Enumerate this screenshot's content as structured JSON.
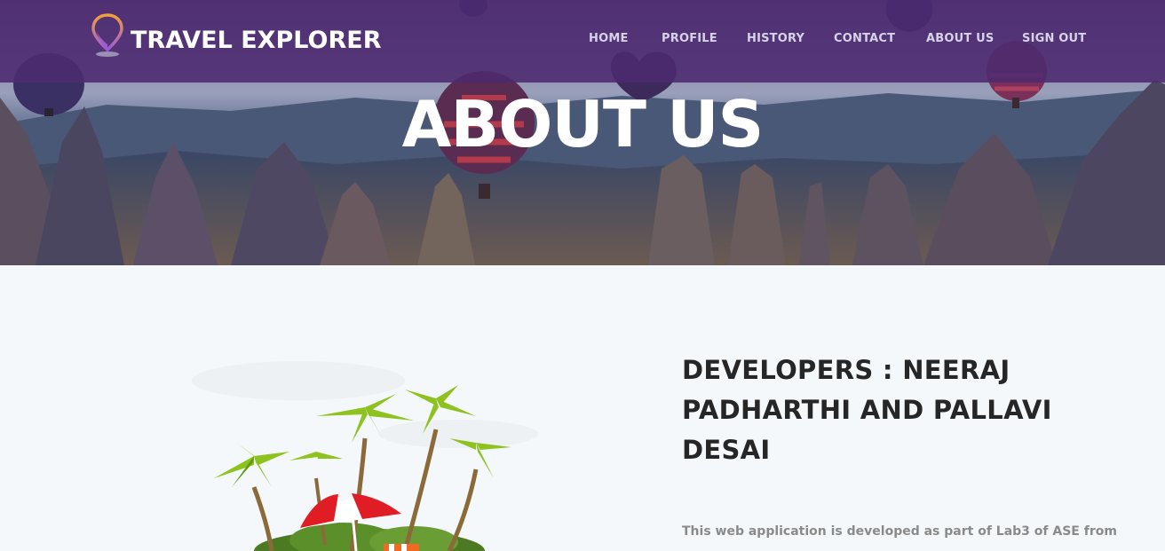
{
  "brand": {
    "name": "TRAVEL EXPLORER",
    "pin_color_top": "#f0a23a",
    "pin_color_bottom": "#9b5ad6"
  },
  "nav": {
    "items": [
      {
        "label": "HOME"
      },
      {
        "label": "PROFILE"
      },
      {
        "label": "HISTORY"
      },
      {
        "label": "CONTACT"
      },
      {
        "label": "ABOUT US"
      },
      {
        "label": "SIGN OUT"
      }
    ]
  },
  "hero": {
    "title": "ABOUT US"
  },
  "about": {
    "heading": "DEVELOPERS : NEERAJ PADHARTHI AND PALLAVI DESAI",
    "description": "This web application is developed as part of Lab3 of ASE from"
  },
  "colors": {
    "navbar": "#4c2a70",
    "hero_text": "#ffffff",
    "heading_text": "#262626",
    "body_text": "#8a8a8a",
    "page_bg": "#f5f8fb"
  },
  "icons": {
    "logo": "map-pin-icon"
  }
}
